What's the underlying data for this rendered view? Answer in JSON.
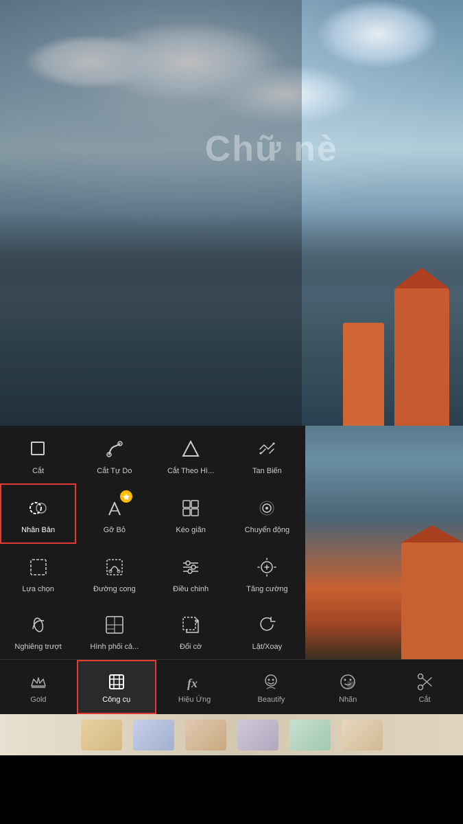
{
  "photo": {
    "watermark": "Chữ nè"
  },
  "tools": {
    "rows": [
      [
        {
          "id": "cat",
          "label": "Cắt",
          "icon": "crop"
        },
        {
          "id": "cat-tu-do",
          "label": "Cắt Tự Do",
          "icon": "freecut"
        },
        {
          "id": "cat-theo-hi",
          "label": "Cắt Theo Hì...",
          "icon": "shapeCut"
        },
        {
          "id": "tan-bien",
          "label": "Tan Biến",
          "icon": "vanish"
        }
      ],
      [
        {
          "id": "nhan-ban",
          "label": "Nhân Bản",
          "icon": "clone",
          "selected": true
        },
        {
          "id": "go-bo",
          "label": "Gỡ Bỏ",
          "icon": "removeBg",
          "gold": true
        },
        {
          "id": "keo-gian",
          "label": "Kéo giãn",
          "icon": "stretch"
        },
        {
          "id": "chuyen-dong",
          "label": "Chuyển động",
          "icon": "motion"
        }
      ],
      [
        {
          "id": "lua-chon",
          "label": "Lựa chọn",
          "icon": "select"
        },
        {
          "id": "duong-cong",
          "label": "Đường cong",
          "icon": "curve"
        },
        {
          "id": "dieu-chinh",
          "label": "Điều chinh",
          "icon": "adjust"
        },
        {
          "id": "tang-cuong",
          "label": "Tăng cường",
          "icon": "enhance"
        }
      ],
      [
        {
          "id": "nghieng-truot",
          "label": "Nghiêng trượt",
          "icon": "tilt"
        },
        {
          "id": "hinh-phoi",
          "label": "Hình phối cả...",
          "icon": "collage"
        },
        {
          "id": "doi-co",
          "label": "Đổi cờ",
          "icon": "resize"
        },
        {
          "id": "lat-xoay",
          "label": "Lật/Xoay",
          "icon": "rotate"
        }
      ]
    ]
  },
  "bottomNav": {
    "items": [
      {
        "id": "gold",
        "label": "Gold",
        "icon": "crown"
      },
      {
        "id": "cong-cu",
        "label": "Công cụ",
        "icon": "crop-tool",
        "active": true
      },
      {
        "id": "hieu-ung",
        "label": "Hiệu Ứng",
        "icon": "fx"
      },
      {
        "id": "beautify",
        "label": "Beautify",
        "icon": "face"
      },
      {
        "id": "nhan",
        "label": "Nhãn",
        "icon": "sticker"
      },
      {
        "id": "cat-nav",
        "label": "Cắt",
        "icon": "scissors"
      }
    ]
  }
}
